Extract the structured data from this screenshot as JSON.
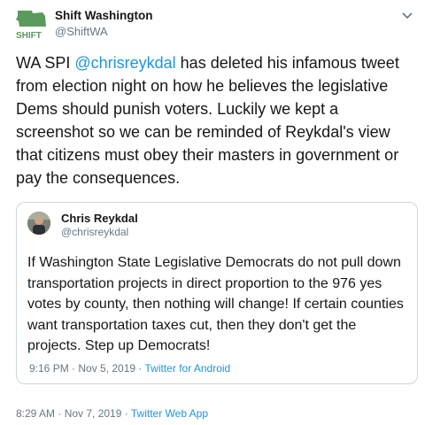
{
  "author": {
    "name": "Shift Washington",
    "handle": "@ShiftWA",
    "logo_text": "SHIFT",
    "brand_color": "#5b9a5d"
  },
  "tweet": {
    "prefix": "WA SPI ",
    "mention": "@chrisreykdal",
    "body": " has deleted his infamous tweet from election night on how he believes the legislative Dems should punish voters. Luckily we kept a screenshot so we can be reminded of Reykdal's view that citizens must obey their masters in government or pay the consequences."
  },
  "quoted": {
    "name": "Chris Reykdal",
    "handle": "@chrisreykdal",
    "text": "If Washington State Legislative Democrats do not pull down transportation projects in direct proportion to the 976 yes votes by county, then nothing will change!  If certain counties want transportation taxes cut, then they don't get the projects.  Step up Democrats!",
    "timestamp": "9:16 PM · Nov 5, 2019 · ",
    "source": "Twitter for Android"
  },
  "meta": {
    "timestamp": "8:29 AM · Nov 7, 2019 · ",
    "source": "Twitter Web App"
  },
  "colors": {
    "link": "#1b95e0",
    "muted": "#657786",
    "border": "#ccd6dd"
  },
  "icons": {
    "more": "chevron-down-icon"
  }
}
